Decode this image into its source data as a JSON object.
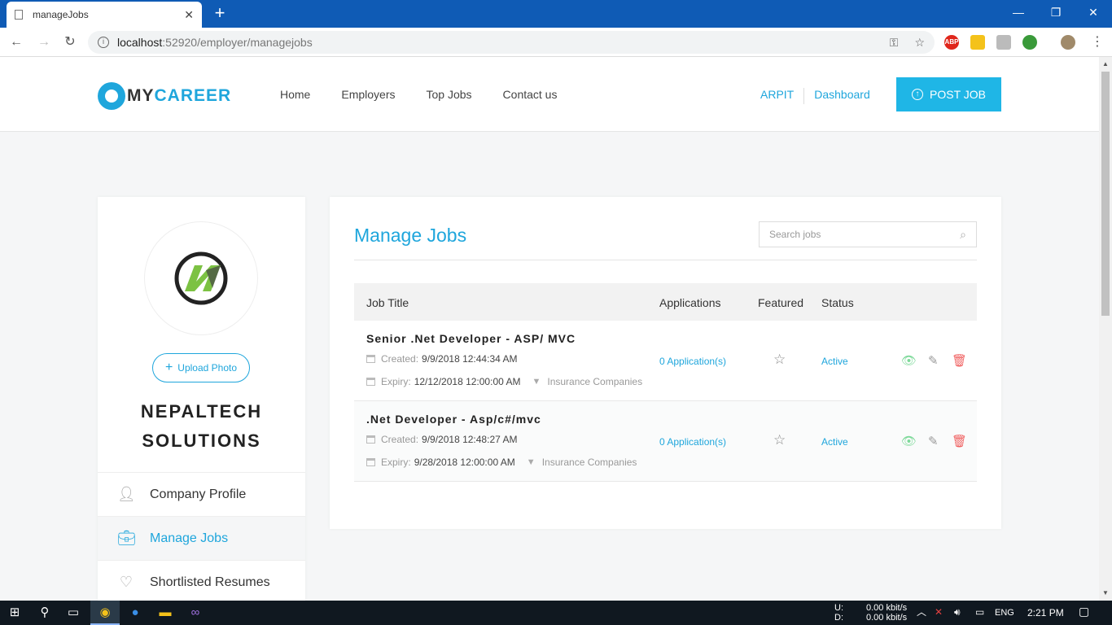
{
  "browser": {
    "tab_title": "manageJobs",
    "url_host": "localhost",
    "url_path": ":52920/employer/managejobs",
    "ext_abp": "ABP"
  },
  "header": {
    "logo_my": "MY",
    "logo_career": "CAREER",
    "nav": [
      "Home",
      "Employers",
      "Top Jobs",
      "Contact us"
    ],
    "user": "ARPIT",
    "dashboard": "Dashboard",
    "post_job": "POST JOB"
  },
  "sidebar": {
    "upload_label": "Upload Photo",
    "company_line1": "NEPALTECH",
    "company_line2": "SOLUTIONS",
    "menu": [
      "Company Profile",
      "Manage Jobs",
      "Shortlisted Resumes"
    ]
  },
  "main": {
    "title": "Manage Jobs",
    "search_placeholder": "Search jobs",
    "columns": [
      "Job Title",
      "Applications",
      "Featured",
      "Status"
    ],
    "created_label": "Created:",
    "expiry_label": "Expiry:",
    "jobs": [
      {
        "title": "Senior .Net Developer - ASP/ MVC",
        "created": "9/9/2018 12:44:34 AM",
        "expiry": "12/12/2018 12:00:00 AM",
        "category": "Insurance Companies",
        "applications": "0 Application(s)",
        "status": "Active"
      },
      {
        "title": ".Net Developer - Asp/c#/mvc",
        "created": "9/9/2018 12:48:27 AM",
        "expiry": "9/28/2018 12:00:00 AM",
        "category": "Insurance Companies",
        "applications": "0 Application(s)",
        "status": "Active"
      }
    ]
  },
  "taskbar": {
    "net_up_label": "U:",
    "net_down_label": "D:",
    "net_up": "0.00 kbit/s",
    "net_down": "0.00 kbit/s",
    "lang": "ENG",
    "time": "2:21 PM"
  },
  "colors": {
    "accent": "#1fa6dc",
    "post_button": "#1fb6e6",
    "browser_bar": "#0f5bb5",
    "delete": "#f06060",
    "view": "#7ed99a"
  }
}
